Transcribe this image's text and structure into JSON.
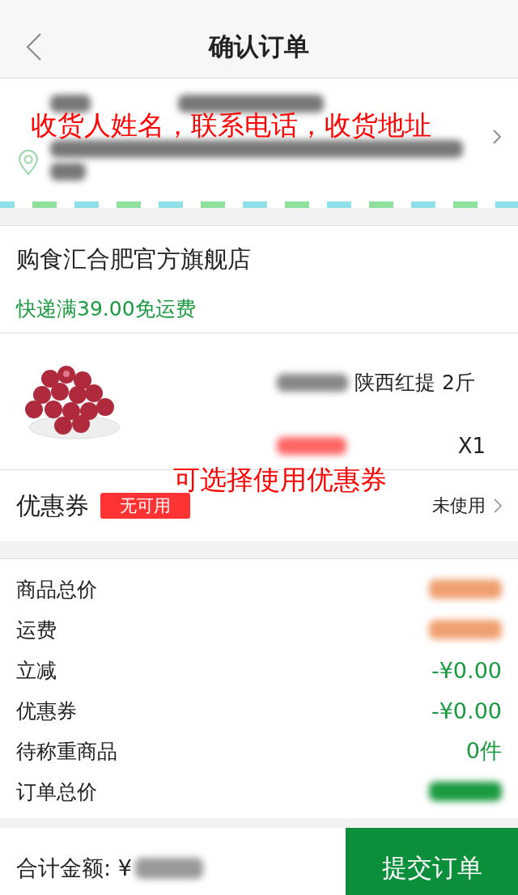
{
  "nav": {
    "title": "确认订单"
  },
  "address": {
    "annotation": "收货人姓名，联系电话，收货地址"
  },
  "store": {
    "name": "购食汇合肥官方旗舰店",
    "shipping_note": "快递满39.00免运费"
  },
  "product": {
    "name": "陕西红提 2斤",
    "quantity": "X1",
    "annotation": "可选择使用优惠券"
  },
  "coupon": {
    "label": "优惠券",
    "badge": "无可用",
    "status": "未使用"
  },
  "summary": [
    {
      "label": "商品总价",
      "color": "#f0a070"
    },
    {
      "label": "运费",
      "color": "#f0a070"
    },
    {
      "label": "立减",
      "value": "-¥0.00"
    },
    {
      "label": "优惠券",
      "value": "-¥0.00"
    },
    {
      "label": "待称重商品",
      "value": "0件"
    },
    {
      "label": "订单总价",
      "color": "#1a9a40"
    }
  ],
  "footer": {
    "total_label": "合计金额: ¥",
    "submit": "提交订单"
  }
}
